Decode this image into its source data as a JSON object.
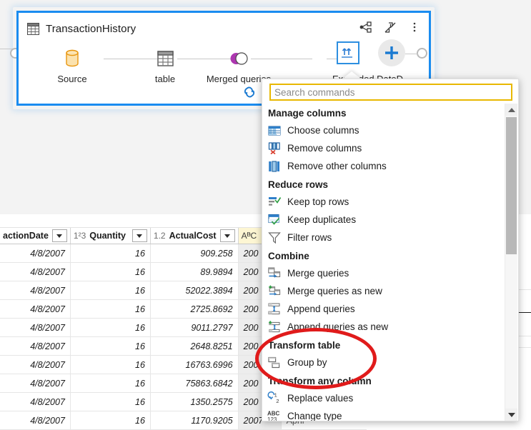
{
  "query": {
    "title": "TransactionHistory",
    "title_icon": "table-grid-icon",
    "actions": [
      {
        "name": "share-diagram-icon",
        "label": "Diagram view"
      },
      {
        "name": "collapse-arrows-icon",
        "label": "Collapse"
      },
      {
        "name": "more-options-icon",
        "label": "More options"
      }
    ],
    "steps": [
      {
        "label": "Source",
        "icon": "database-cylinder-icon"
      },
      {
        "label": "table",
        "icon": "table-grid-icon"
      },
      {
        "label": "Merged queries",
        "icon": "merge-venn-icon"
      },
      {
        "label": "Expanded DateD",
        "icon": "expand-columns-icon"
      }
    ],
    "add_step_label": "+",
    "link_icon": "linked-chain-icon"
  },
  "menu": {
    "search": {
      "placeholder": "Search commands",
      "value": "",
      "border_color": "#e8b800"
    },
    "groups": [
      {
        "title": "Manage columns",
        "items": [
          {
            "label": "Choose columns",
            "icon": "choose-columns-icon"
          },
          {
            "label": "Remove columns",
            "icon": "remove-columns-icon"
          },
          {
            "label": "Remove other columns",
            "icon": "remove-other-columns-icon"
          }
        ]
      },
      {
        "title": "Reduce rows",
        "items": [
          {
            "label": "Keep top rows",
            "icon": "keep-top-rows-icon"
          },
          {
            "label": "Keep duplicates",
            "icon": "keep-duplicates-icon"
          },
          {
            "label": "Filter rows",
            "icon": "funnel-filter-icon"
          }
        ]
      },
      {
        "title": "Combine",
        "items": [
          {
            "label": "Merge queries",
            "icon": "merge-queries-icon"
          },
          {
            "label": "Merge queries as new",
            "icon": "merge-queries-as-new-icon"
          },
          {
            "label": "Append queries",
            "icon": "append-queries-icon"
          },
          {
            "label": "Append queries as new",
            "icon": "append-queries-as-new-icon"
          }
        ]
      },
      {
        "title": "Transform table",
        "items": [
          {
            "label": "Group by",
            "icon": "group-by-icon"
          }
        ]
      },
      {
        "title": "Transform any column",
        "items": [
          {
            "label": "Replace values",
            "icon": "replace-values-icon"
          },
          {
            "label": "Change type",
            "icon": "change-type-abc123-icon"
          }
        ]
      }
    ]
  },
  "grid": {
    "columns": [
      {
        "header": "actionDate",
        "type_badge": "",
        "has_filter": true,
        "align": "right",
        "highlight": false
      },
      {
        "header": "Quantity",
        "type_badge": "1²3",
        "has_filter": true,
        "align": "right",
        "highlight": false
      },
      {
        "header": "ActualCost",
        "type_badge": "1.2",
        "has_filter": true,
        "align": "right",
        "highlight": false
      },
      {
        "header": "",
        "type_badge": "AᴯC",
        "has_filter": false,
        "align": "left",
        "highlight": true
      }
    ],
    "rows": [
      [
        "4/8/2007",
        "16",
        "909.258",
        "200"
      ],
      [
        "4/8/2007",
        "16",
        "89.9894",
        "200"
      ],
      [
        "4/8/2007",
        "16",
        "52022.3894",
        "200"
      ],
      [
        "4/8/2007",
        "16",
        "2725.8692",
        "200"
      ],
      [
        "4/8/2007",
        "16",
        "9011.2797",
        "200"
      ],
      [
        "4/8/2007",
        "16",
        "2648.8251",
        "200"
      ],
      [
        "4/8/2007",
        "16",
        "16763.6996",
        "200"
      ],
      [
        "4/8/2007",
        "16",
        "75863.6842",
        "200"
      ],
      [
        "4/8/2007",
        "16",
        "1350.2575",
        "200"
      ],
      [
        "4/8/2007",
        "16",
        "1170.9205",
        "2007"
      ]
    ],
    "partial_cell": "April"
  },
  "annotation": {
    "shape": "ellipse",
    "color": "#e01b1b",
    "targets": [
      "Transform table",
      "Group by"
    ]
  }
}
